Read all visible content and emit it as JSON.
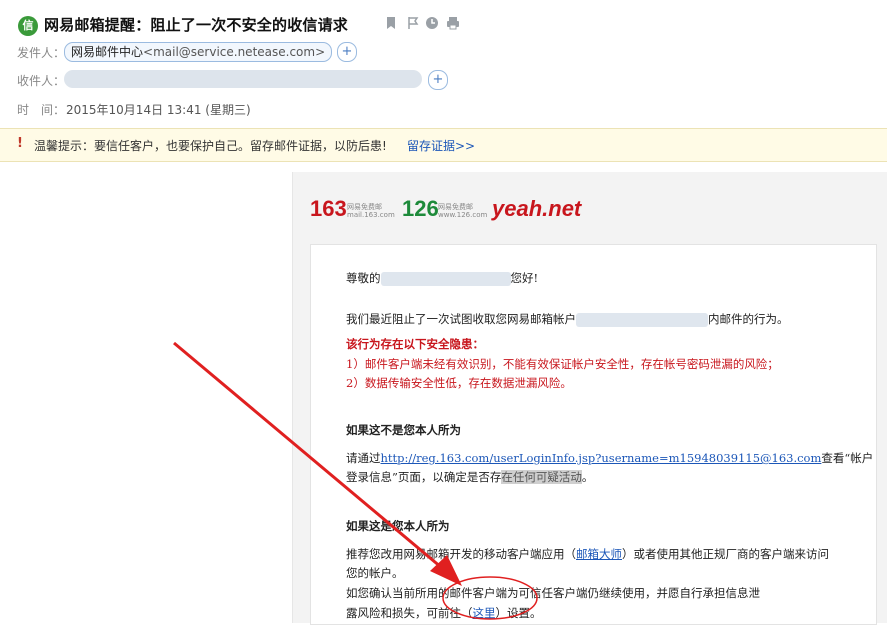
{
  "header": {
    "logo_text": "信",
    "subject": "网易邮箱提醒：阻止了一次不安全的收信请求",
    "icons": [
      "flag-bookmark-icon",
      "flag-icon",
      "clock-icon",
      "print-icon"
    ],
    "sender_label": "发件人：",
    "sender_name": "网易邮件中心",
    "sender_addr": "<mail@service.netease.com>",
    "add_symbol": "+",
    "recipient_label": "收件人：",
    "time_label": "时　间：",
    "time_value": "2015年10月14日 13:41 (星期三)"
  },
  "warning": {
    "icon": "!",
    "text": "温馨提示：要信任客户，也要保护自己。留存邮件证据，以防后患!",
    "link": "留存证据>>"
  },
  "brands": {
    "b163": "163",
    "b163_sub1": "网易免费邮",
    "b163_sub2": "mail.163.com",
    "b126": "126",
    "b126_sub1": "网易免费邮",
    "b126_sub2": "www.126.com",
    "yeah": "yeah.net"
  },
  "body": {
    "greeting_pre": "尊敬的",
    "greeting_post": "您好!",
    "p1_pre": "我们最近阻止了一次试图收取您网易邮箱帐户",
    "p1_post": "内邮件的行为。",
    "risk_title": "该行为存在以下安全隐患：",
    "risk1": "1）邮件客户端未经有效识别，不能有效保证帐户安全性，存在帐号密码泄漏的风险；",
    "risk2": "2）数据传输安全性低，存在数据泄漏风险。",
    "not_self_title": "如果这不是您本人所为",
    "not_self_pre": "请通过",
    "not_self_link": "http://reg.163.com/userLoginInfo.jsp?username=m15948039115@163.com",
    "not_self_post": "查看“帐户",
    "not_self_line2_pre": "登录信息”页面，以确定是否存",
    "not_self_line2_hl": "在任何可疑活动",
    "not_self_line2_post": "。",
    "self_title": "如果这是您本人所为",
    "self_p1_pre": "推荐您改用网易邮箱开发的移动客户端应用（",
    "self_p1_link": "邮箱大师",
    "self_p1_post": "）或者使用其他正规厂商的客户端来访问",
    "self_p1_line2": "您的帐户。",
    "self_p2": "如您确认当前所用的邮件客户端为可信任客户端仍继续使用，并愿自行承担信息泄",
    "self_p3_pre": "露风险和损失，可前往（",
    "self_p3_link": "这里",
    "self_p3_post": "）设置。"
  },
  "colors": {
    "brand_red": "#c8161d",
    "brand_green": "#1d8a3a",
    "link_blue": "#1c57b8",
    "arrow_red": "#e02020"
  }
}
